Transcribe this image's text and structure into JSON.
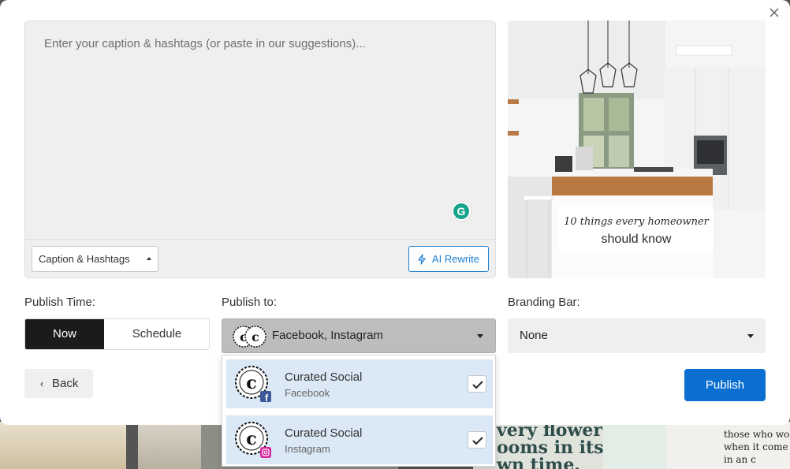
{
  "caption": {
    "placeholder": "Enter your caption & hashtags (or paste in our suggestions)...",
    "value": "",
    "selector_label": "Caption & Hashtags",
    "ai_button_label": "AI Rewrite"
  },
  "preview": {
    "overlay_line1": "10 things every homeowner",
    "overlay_line2": "should know"
  },
  "publish_time": {
    "label": "Publish Time:",
    "options": [
      "Now",
      "Schedule"
    ],
    "selected": "Now"
  },
  "publish_to": {
    "label": "Publish to:",
    "value": "Facebook, Instagram",
    "accounts": [
      {
        "name": "Curated Social",
        "platform": "Facebook",
        "checked": true
      },
      {
        "name": "Curated Social",
        "platform": "Instagram",
        "checked": true
      }
    ]
  },
  "branding_bar": {
    "label": "Branding Bar:",
    "value": "None"
  },
  "actions": {
    "back_label": "Back",
    "publish_label": "Publish"
  },
  "background": {
    "tile_text_a": "very flower\nooms in its\nwn time.",
    "tile_text_b": "those who wo\nwhen it come\nin an c"
  },
  "colors": {
    "primary": "#0a6fd1",
    "selected_segment": "#1b1b1b",
    "dropdown_item_bg": "#dbe8f5",
    "grammarly": "#15a38a"
  },
  "icons": {
    "close": "close-icon",
    "grammarly": "grammarly-icon",
    "ai": "lightning-icon",
    "back": "chevron-left-icon",
    "facebook": "facebook-icon",
    "instagram": "instagram-icon",
    "check": "check-icon"
  }
}
